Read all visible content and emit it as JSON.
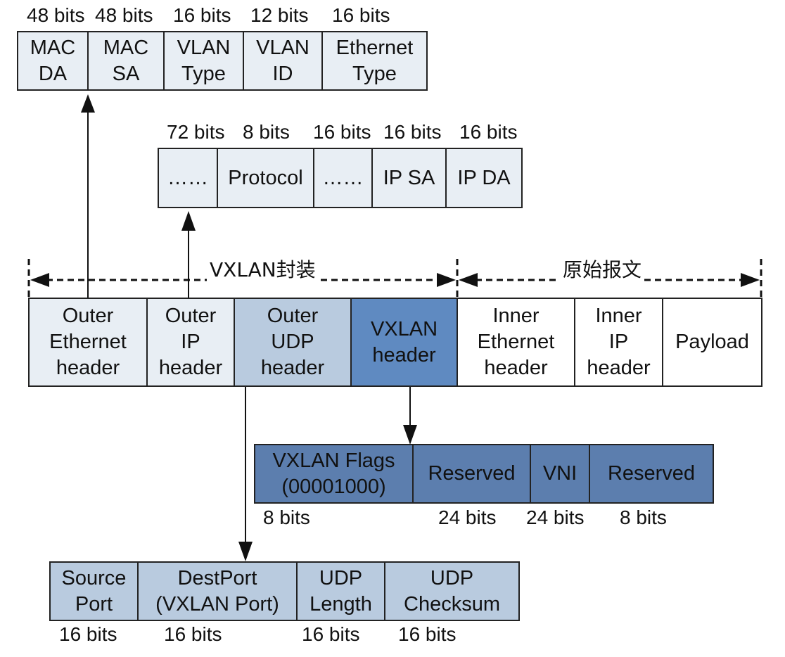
{
  "ethernet_header": {
    "fields": [
      {
        "label": "MAC\nDA",
        "bits": "48 bits"
      },
      {
        "label": "MAC\nSA",
        "bits": "48 bits"
      },
      {
        "label": "VLAN\nType",
        "bits": "16 bits"
      },
      {
        "label": "VLAN\nID",
        "bits": "12 bits"
      },
      {
        "label": "Ethernet\nType",
        "bits": "16 bits"
      }
    ]
  },
  "ip_header": {
    "fields": [
      {
        "label": "……",
        "bits": "72 bits"
      },
      {
        "label": "Protocol",
        "bits": "8 bits"
      },
      {
        "label": "……",
        "bits": "16 bits"
      },
      {
        "label": "IP SA",
        "bits": "16 bits"
      },
      {
        "label": "IP DA",
        "bits": "16 bits"
      }
    ]
  },
  "spans": {
    "encapsulation": "VXLAN封装",
    "original": "原始报文"
  },
  "packet": {
    "fields": [
      {
        "label": "Outer\nEthernet\nheader"
      },
      {
        "label": "Outer\nIP\nheader"
      },
      {
        "label": "Outer\nUDP\nheader"
      },
      {
        "label": "VXLAN\nheader"
      },
      {
        "label": "Inner\nEthernet\nheader"
      },
      {
        "label": "Inner\nIP\nheader"
      },
      {
        "label": "Payload"
      }
    ]
  },
  "vxlan_header": {
    "fields": [
      {
        "label": "VXLAN Flags\n(00001000)",
        "bits": "8 bits"
      },
      {
        "label": "Reserved",
        "bits": "24 bits"
      },
      {
        "label": "VNI",
        "bits": "24 bits"
      },
      {
        "label": "Reserved",
        "bits": "8 bits"
      }
    ]
  },
  "udp_header": {
    "fields": [
      {
        "label": "Source\nPort",
        "bits": "16 bits"
      },
      {
        "label": "DestPort\n(VXLAN Port)",
        "bits": "16 bits"
      },
      {
        "label": "UDP\nLength",
        "bits": "16 bits"
      },
      {
        "label": "UDP\nChecksum",
        "bits": "16 bits"
      }
    ]
  },
  "colors": {
    "light": "#e8eef4",
    "udp": "#b9cbdf",
    "vxlan": "#5f8ac1",
    "vxlan_fields": "#5c7eae"
  }
}
